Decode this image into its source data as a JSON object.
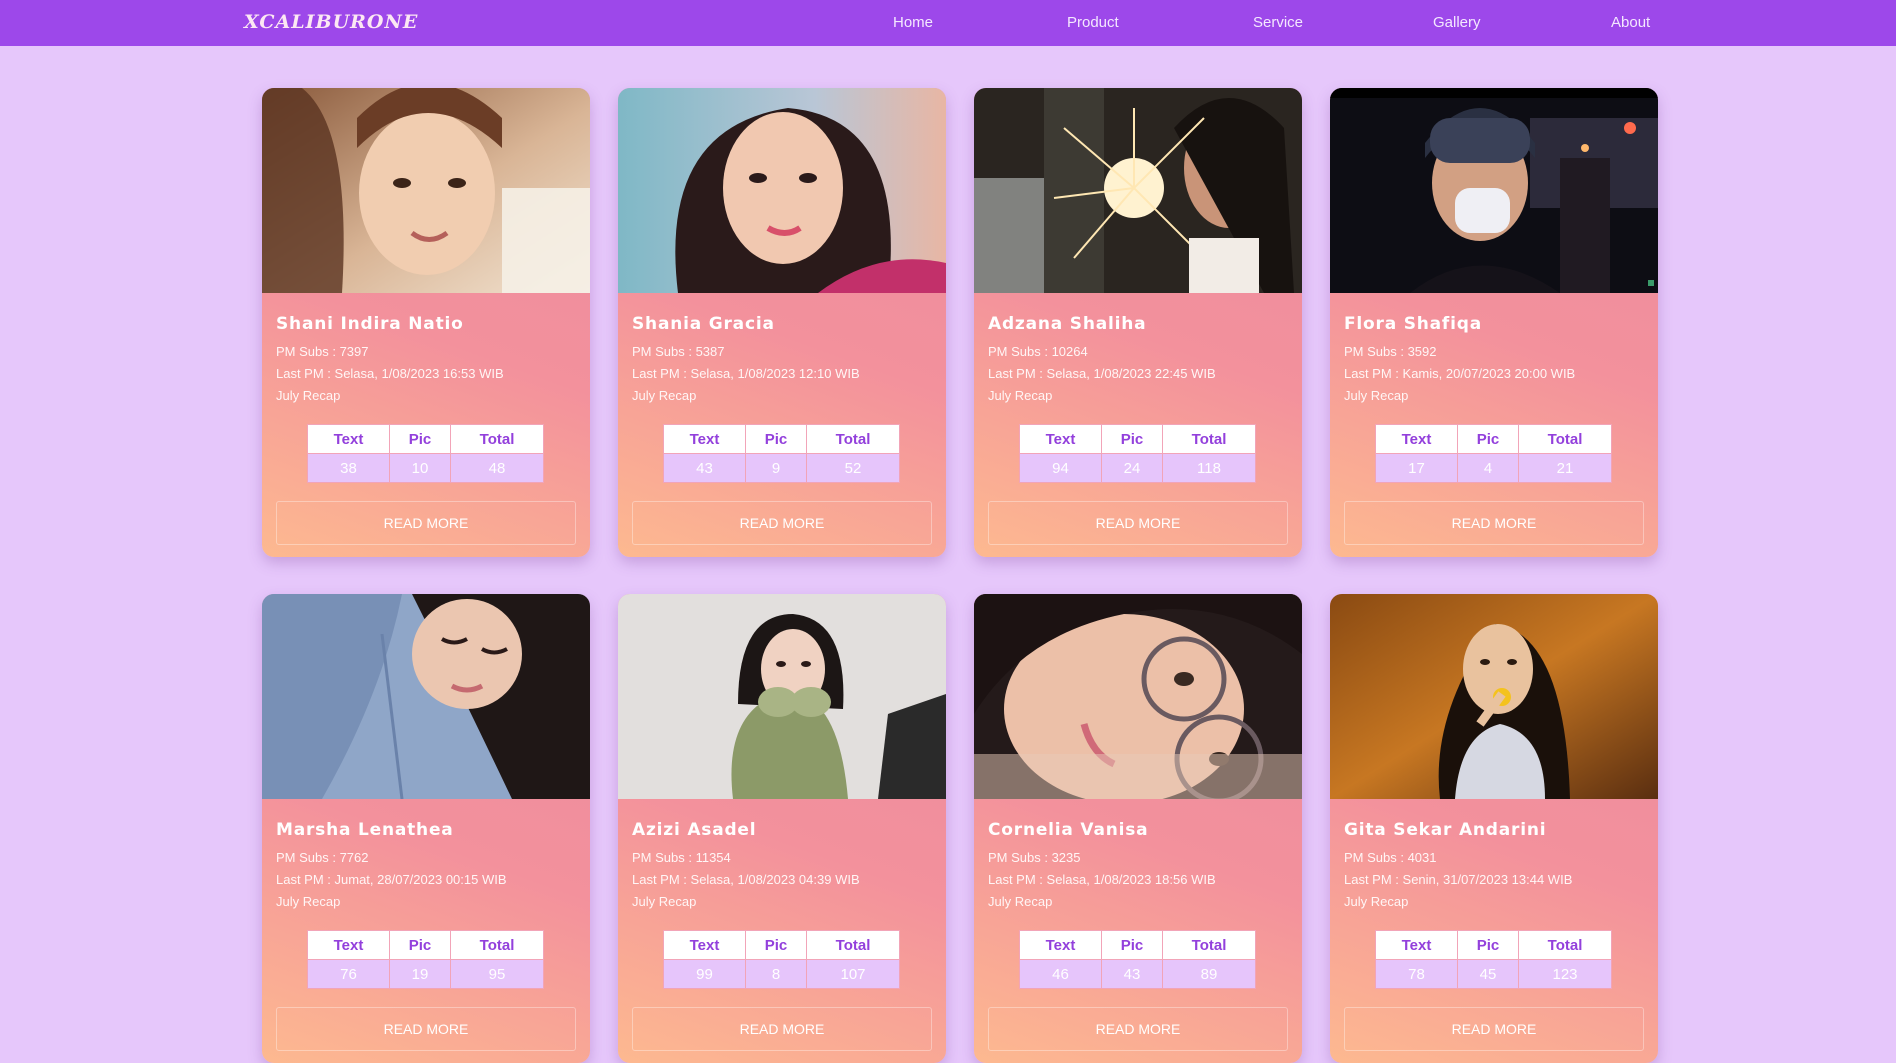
{
  "nav": {
    "brand": "XCALIBURONE",
    "links": [
      "Home",
      "Product",
      "Service",
      "Gallery",
      "About"
    ]
  },
  "table_headers": [
    "Text",
    "Pic",
    "Total"
  ],
  "read_more_label": "READ MORE",
  "cards": [
    {
      "name": "Shani Indira Natio",
      "subs": "PM Subs : 7397",
      "last_pm": "Last PM : Selasa, 1/08/2023 16:53 WIB",
      "recap": "July Recap",
      "text": "38",
      "pic": "10",
      "total": "48"
    },
    {
      "name": "Shania Gracia",
      "subs": "PM Subs : 5387",
      "last_pm": "Last PM : Selasa, 1/08/2023 12:10 WIB",
      "recap": "July Recap",
      "text": "43",
      "pic": "9",
      "total": "52"
    },
    {
      "name": "Adzana Shaliha",
      "subs": "PM Subs : 10264",
      "last_pm": "Last PM : Selasa, 1/08/2023 22:45 WIB",
      "recap": "July Recap",
      "text": "94",
      "pic": "24",
      "total": "118"
    },
    {
      "name": "Flora Shafiqa",
      "subs": "PM Subs : 3592",
      "last_pm": "Last PM : Kamis, 20/07/2023 20:00 WIB",
      "recap": "July Recap",
      "text": "17",
      "pic": "4",
      "total": "21"
    },
    {
      "name": "Marsha Lenathea",
      "subs": "PM Subs : 7762",
      "last_pm": "Last PM : Jumat, 28/07/2023 00:15 WIB",
      "recap": "July Recap",
      "text": "76",
      "pic": "19",
      "total": "95"
    },
    {
      "name": "Azizi Asadel",
      "subs": "PM Subs : 11354",
      "last_pm": "Last PM : Selasa, 1/08/2023 04:39 WIB",
      "recap": "July Recap",
      "text": "99",
      "pic": "8",
      "total": "107"
    },
    {
      "name": "Cornelia Vanisa",
      "subs": "PM Subs : 3235",
      "last_pm": "Last PM : Selasa, 1/08/2023 18:56 WIB",
      "recap": "July Recap",
      "text": "46",
      "pic": "43",
      "total": "89"
    },
    {
      "name": "Gita Sekar Andarini",
      "subs": "PM Subs : 4031",
      "last_pm": "Last PM : Senin, 31/07/2023 13:44 WIB",
      "recap": "July Recap",
      "text": "78",
      "pic": "45",
      "total": "123"
    }
  ]
}
